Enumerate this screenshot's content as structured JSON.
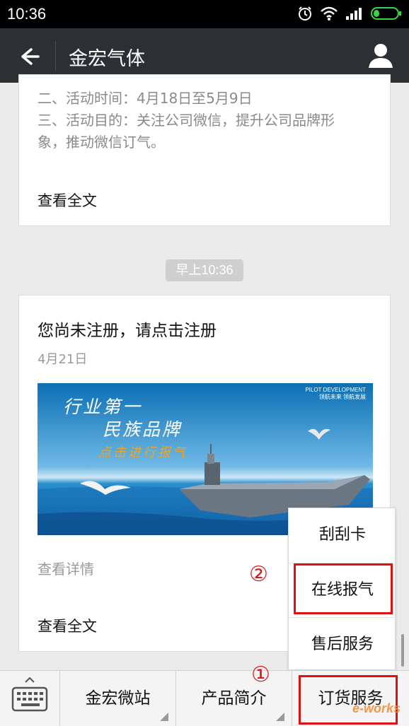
{
  "status_bar": {
    "time": "10:36",
    "icons": [
      "alarm-icon",
      "wifi-icon",
      "signal-icon",
      "battery-icon"
    ]
  },
  "header": {
    "title": "金宏气体",
    "back_icon": "back-arrow-icon",
    "profile_icon": "profile-icon"
  },
  "messages": [
    {
      "lines": [
        " 二、活动时间：4月18日至5月9日",
        "三、活动目的：关注公司微信，提升公司品牌形",
        "象，推动微信订气。"
      ],
      "read_full": "查看全文"
    },
    {
      "timestamp": "早上10:36",
      "title": "您尚未注册，请点击注册",
      "date": "4月21日",
      "image": {
        "line1": "行业第一",
        "line2": "民族品牌",
        "line3": "点击进行报气",
        "brand": "PILOT DEVELOPMENT",
        "brand_sub": "领航未来  领航发展"
      },
      "view_details": "查看详情",
      "read_full": "查看全文"
    }
  ],
  "popup_menu": {
    "items": [
      {
        "label": "刮刮卡"
      },
      {
        "label": "在线报气",
        "highlighted": true
      },
      {
        "label": "售后服务"
      }
    ]
  },
  "bottom_bar": {
    "keyboard_icon": "keyboard-icon",
    "tabs": [
      {
        "label": "金宏微站"
      },
      {
        "label": "产品简介"
      },
      {
        "label": "订货服务",
        "highlighted": true
      }
    ]
  },
  "annotations": {
    "marker_1": "①",
    "marker_2": "②"
  },
  "watermark": "e-works",
  "colors": {
    "status_bar": "#000000",
    "nav_bar": "#2d3033",
    "background": "#ebebeb",
    "highlight": "#e01010",
    "banner_accent": "#f2a31e"
  }
}
